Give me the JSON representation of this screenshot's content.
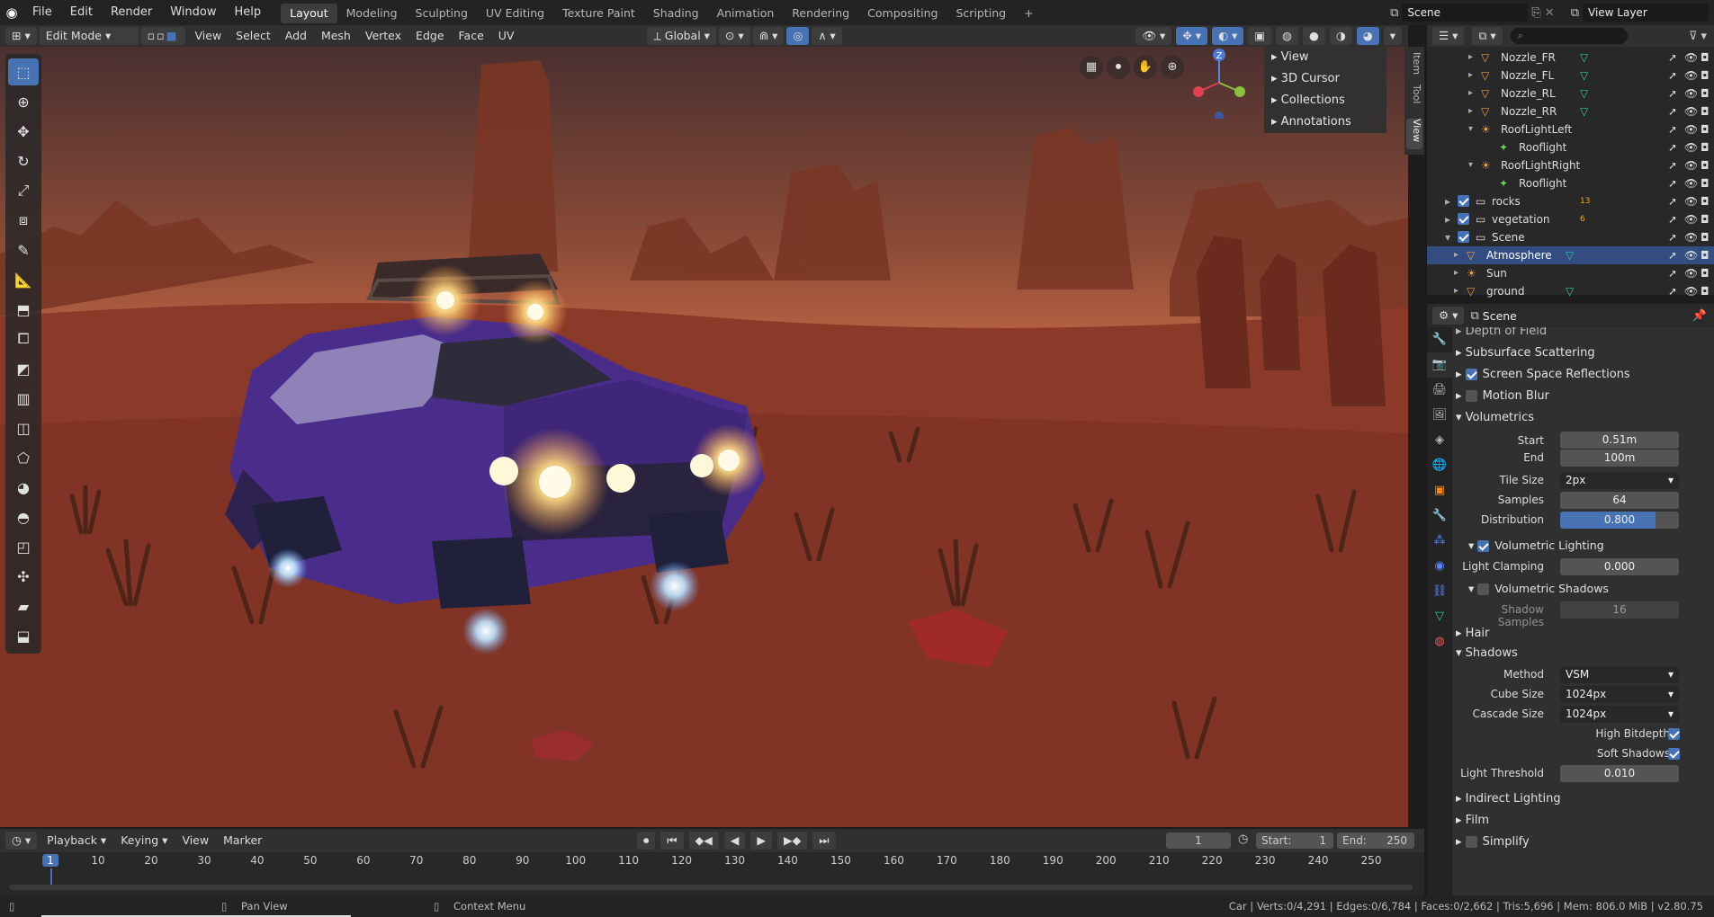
{
  "topbar": {
    "menus": [
      "File",
      "Edit",
      "Render",
      "Window",
      "Help"
    ],
    "workspaces": [
      "Layout",
      "Modeling",
      "Sculpting",
      "UV Editing",
      "Texture Paint",
      "Shading",
      "Animation",
      "Rendering",
      "Compositing",
      "Scripting"
    ],
    "active_workspace": "Layout",
    "add_tab": "+",
    "scene_name": "Scene",
    "view_layer": "View Layer"
  },
  "viewport_header": {
    "mode": "Edit Mode",
    "menus": [
      "View",
      "Select",
      "Add",
      "Mesh",
      "Vertex",
      "Edge",
      "Face",
      "UV"
    ],
    "transform_orientation": "Global"
  },
  "npanel": {
    "items": [
      "View",
      "3D Cursor",
      "Collections",
      "Annotations"
    ],
    "tabs": [
      "Item",
      "Tool",
      "View"
    ]
  },
  "gizmo": {
    "z_label": "Z"
  },
  "outliner": {
    "search_placeholder": "",
    "rows": [
      {
        "name": "Nozzle_FR",
        "indent": 2
      },
      {
        "name": "Nozzle_FL",
        "indent": 2
      },
      {
        "name": "Nozzle_RL",
        "indent": 2
      },
      {
        "name": "Nozzle_RR",
        "indent": 2
      },
      {
        "name": "RoofLightLeft",
        "indent": 2
      },
      {
        "name": "Rooflight",
        "indent": 3
      },
      {
        "name": "RoofLightRight",
        "indent": 2
      },
      {
        "name": "Rooflight",
        "indent": 3
      },
      {
        "name": "rocks",
        "indent": 0,
        "badge": "13"
      },
      {
        "name": "vegetation",
        "indent": 0,
        "badge": "6"
      },
      {
        "name": "Scene",
        "indent": 0
      },
      {
        "name": "Atmosphere",
        "indent": 1,
        "selected": true
      },
      {
        "name": "Sun",
        "indent": 1
      },
      {
        "name": "ground",
        "indent": 1
      }
    ]
  },
  "properties": {
    "context": "Scene",
    "panels": {
      "depth_of_field": "Depth of Field",
      "subsurface": "Subsurface Scattering",
      "ssr": "Screen Space Reflections",
      "motion_blur": "Motion Blur",
      "volumetrics": "Volumetrics",
      "hair": "Hair",
      "shadows": "Shadows",
      "indirect": "Indirect Lighting",
      "film": "Film",
      "simplify": "Simplify"
    },
    "vol": {
      "start_label": "Start",
      "start": "0.51m",
      "end_label": "End",
      "end": "100m",
      "tile_label": "Tile Size",
      "tile": "2px",
      "samples_label": "Samples",
      "samples": "64",
      "dist_label": "Distribution",
      "dist": "0.800",
      "dist_fraction": 0.8,
      "vl_label": "Volumetric Lighting",
      "clamp_label": "Light Clamping",
      "clamp": "0.000",
      "vs_label": "Volumetric Shadows",
      "ss_label": "Shadow Samples",
      "ss": "16"
    },
    "shadows": {
      "method_label": "Method",
      "method": "VSM",
      "cube_label": "Cube Size",
      "cube": "1024px",
      "cascade_label": "Cascade Size",
      "cascade": "1024px",
      "hb_label": "High Bitdepth",
      "soft_label": "Soft Shadows",
      "thresh_label": "Light Threshold",
      "thresh": "0.010"
    }
  },
  "timeline": {
    "menus": [
      "Playback",
      "Keying",
      "View",
      "Marker"
    ],
    "current_frame": "1",
    "start_label": "Start:",
    "start": "1",
    "end_label": "End:",
    "end": "250",
    "ticks": [
      "1",
      "10",
      "20",
      "30",
      "40",
      "50",
      "60",
      "70",
      "80",
      "90",
      "100",
      "110",
      "120",
      "130",
      "140",
      "150",
      "160",
      "170",
      "180",
      "190",
      "200",
      "210",
      "220",
      "230",
      "240",
      "250"
    ]
  },
  "statusbar": {
    "left": "Pan View",
    "mid": "Context Menu",
    "right": "Car | Verts:0/4,291 | Edges:0/6,784 | Faces:0/2,662 | Tris:5,696 | Mem: 806.0 MiB | v2.80.75"
  },
  "colors": {
    "accent": "#4772b3",
    "selected_row": "#334d80"
  }
}
